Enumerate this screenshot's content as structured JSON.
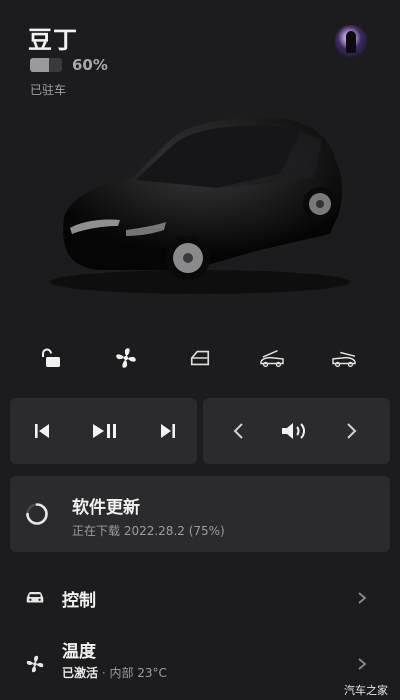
{
  "header": {
    "car_name": "豆丁",
    "battery_percent": "60%",
    "battery_level": 0.6,
    "status": "已驻车"
  },
  "quick_controls": [
    {
      "name": "lock",
      "icon": "unlock-icon"
    },
    {
      "name": "climate",
      "icon": "fan-icon"
    },
    {
      "name": "frunk-door",
      "icon": "door-icon"
    },
    {
      "name": "frunk",
      "icon": "frunk-icon"
    },
    {
      "name": "trunk",
      "icon": "trunk-icon"
    }
  ],
  "media": {
    "playback": [
      "previous-track-icon",
      "play-pause-icon",
      "next-track-icon"
    ],
    "volume": [
      "volume-down-icon",
      "volume-icon",
      "volume-up-icon"
    ]
  },
  "update": {
    "title": "软件更新",
    "subtitle": "正在下载 2022.28.2 (75%)",
    "progress": 0.75
  },
  "menu": {
    "controls": {
      "title": "控制"
    },
    "climate": {
      "title": "温度",
      "status": "已激活",
      "separator": " · ",
      "detail": "内部 23°C"
    }
  },
  "watermark": "汽车之家",
  "colors": {
    "background": "#1c1c1e",
    "panel": "#2b2b2e",
    "text": "#f2f2f2",
    "muted": "#9c9c9e"
  }
}
